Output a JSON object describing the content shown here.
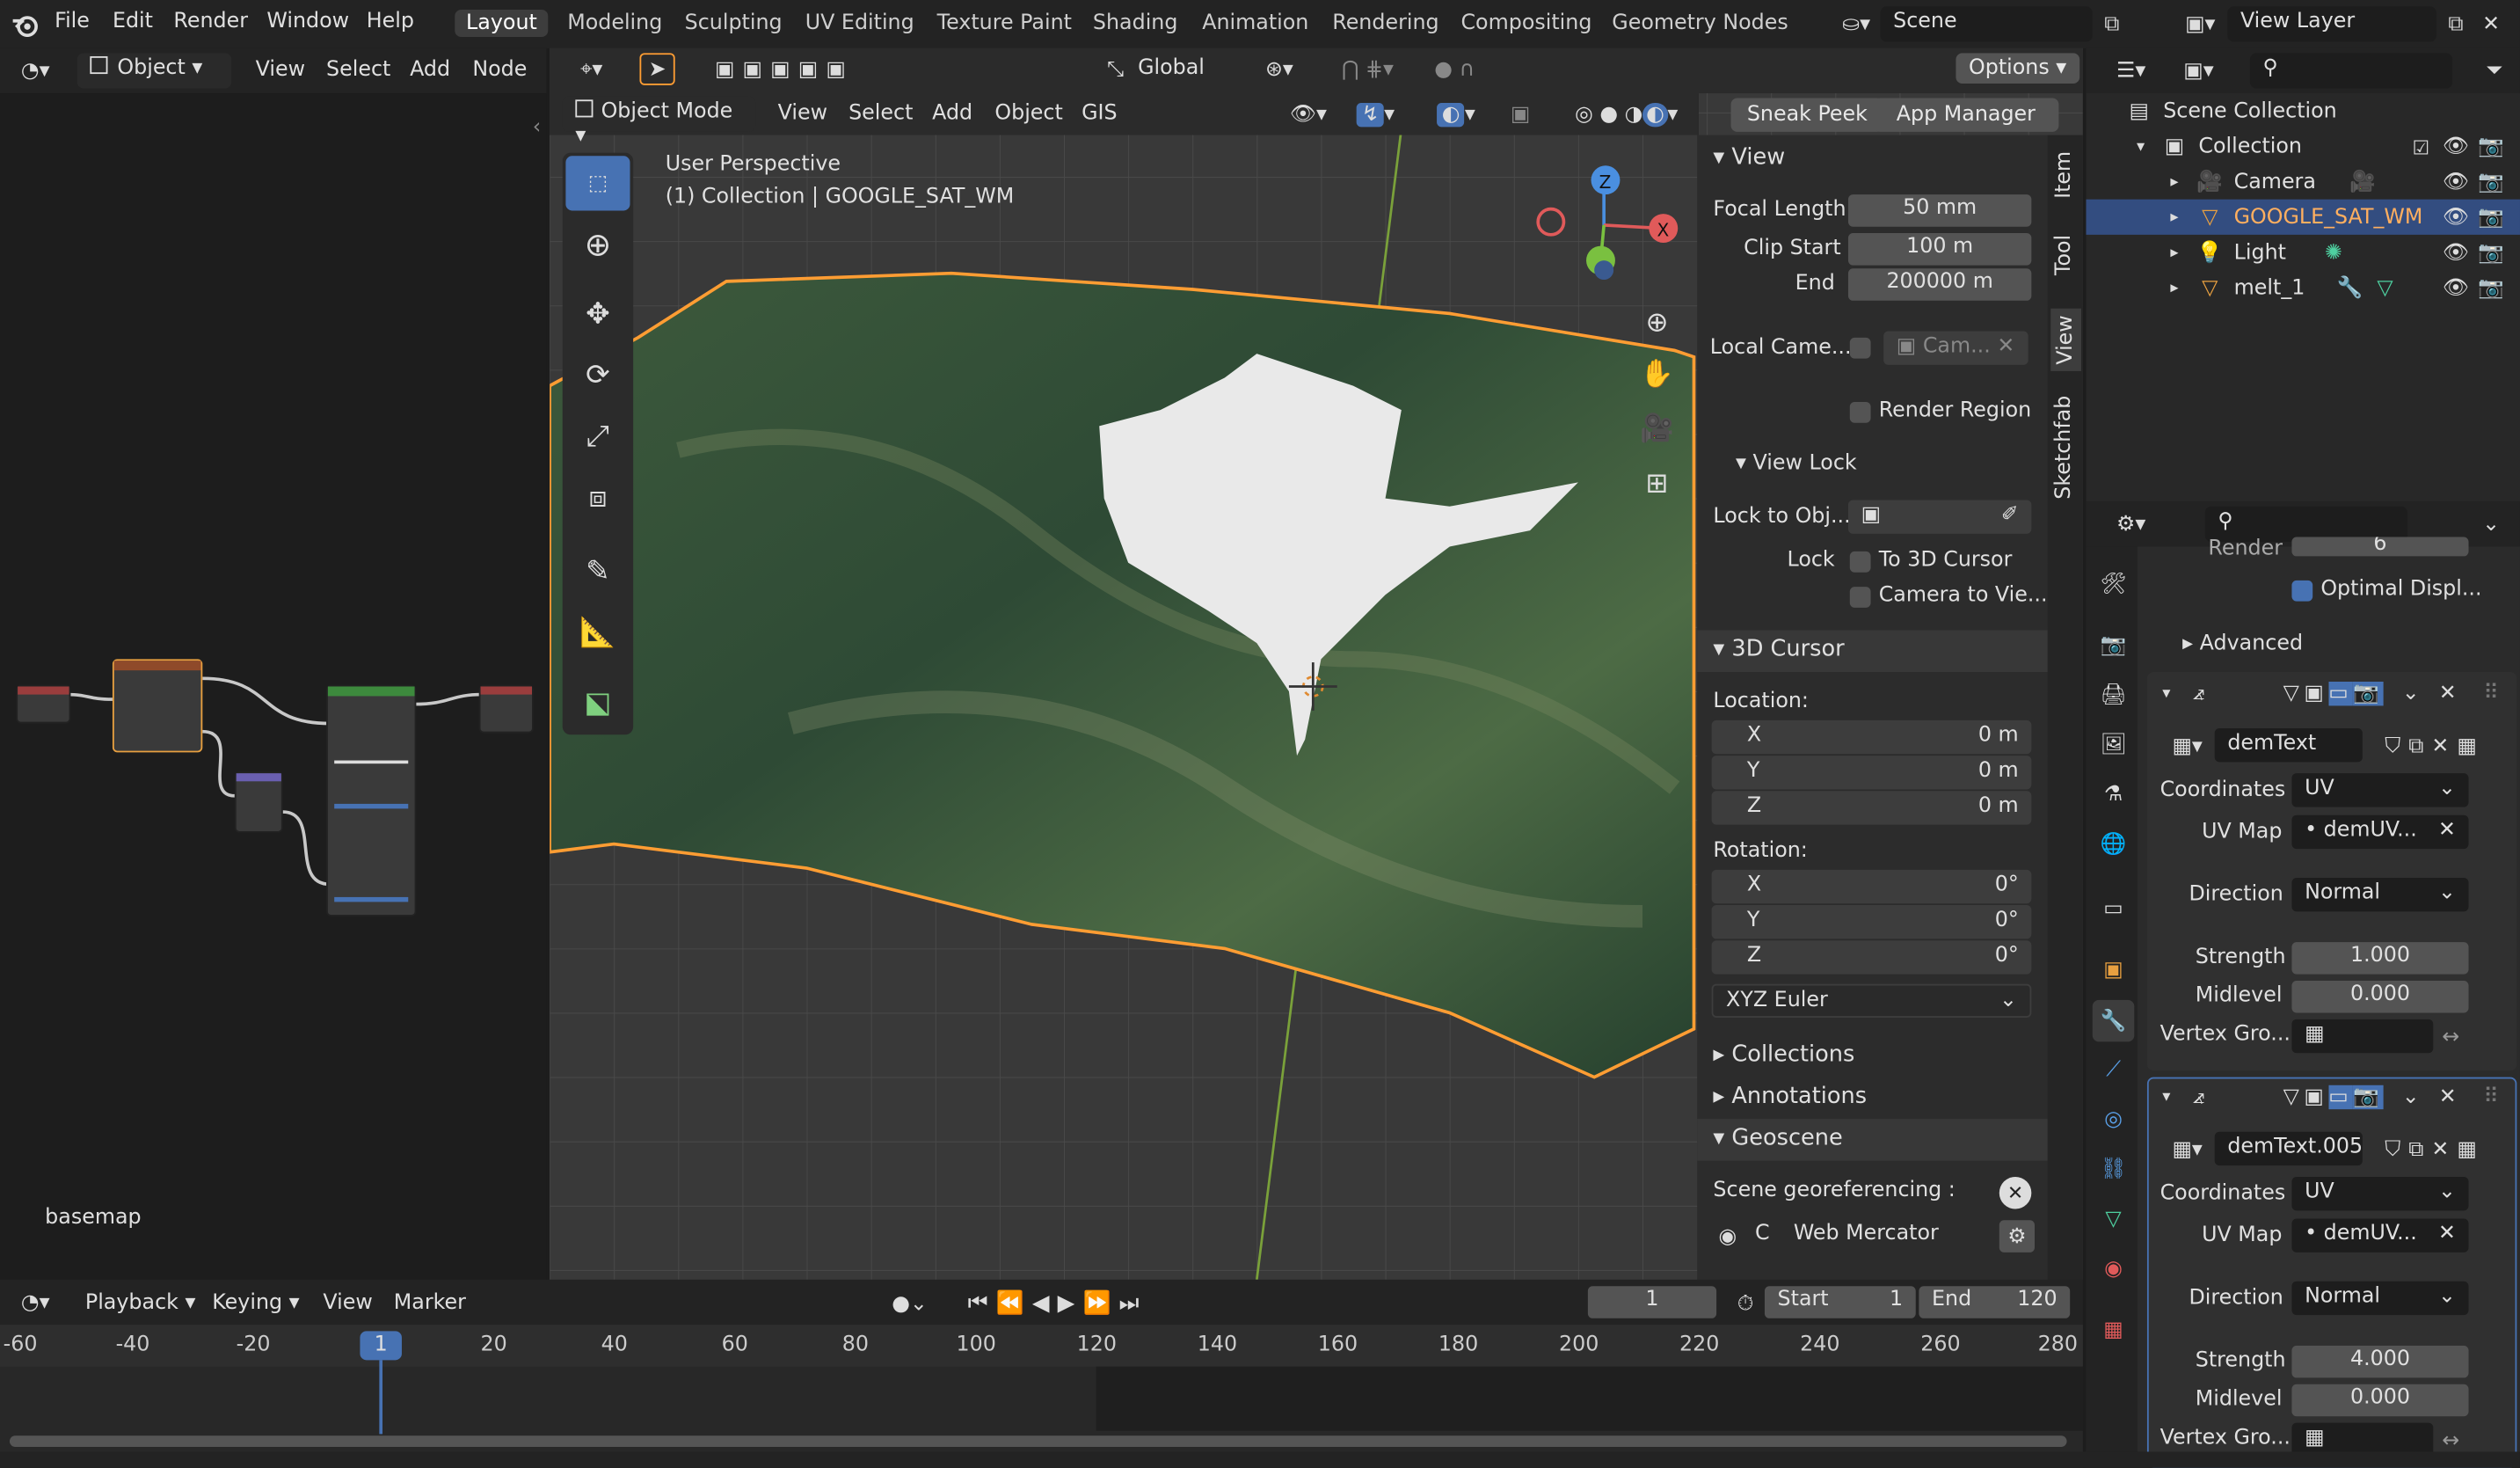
{
  "app": {
    "logo": "blender-logo"
  },
  "menu": [
    "File",
    "Edit",
    "Render",
    "Window",
    "Help"
  ],
  "workspaces": [
    "Layout",
    "Modeling",
    "Sculpting",
    "UV Editing",
    "Texture Paint",
    "Shading",
    "Animation",
    "Rendering",
    "Compositing",
    "Geometry Nodes"
  ],
  "scene": {
    "label": "Scene",
    "view_layer": "View Layer"
  },
  "node_editor": {
    "mode": "Object",
    "menus": [
      "View",
      "Select",
      "Add",
      "Node"
    ],
    "label": "basemap"
  },
  "viewport": {
    "header_menus": [
      "View",
      "Select",
      "Add",
      "Object",
      "GIS"
    ],
    "mode": "Object Mode",
    "orientation": "Global",
    "options": "Options",
    "sneak_peek": "Sneak Peek",
    "app_manager": "App Manager",
    "overlay_line1": "User Perspective",
    "overlay_line2": "(1) Collection | GOOGLE_SAT_WM",
    "gizmo": {
      "z": "Z",
      "x": "X"
    }
  },
  "npanel": {
    "tabs": [
      "Item",
      "Tool",
      "View",
      "Sketchfab"
    ],
    "view": {
      "title": "View",
      "focal_length_label": "Focal Length",
      "focal_length": "50 mm",
      "clip_start_label": "Clip Start",
      "clip_start": "100 m",
      "end_label": "End",
      "end": "200000 m",
      "local_camera_label": "Local Came...",
      "local_camera_field": "Cam...",
      "render_region": "Render Region"
    },
    "view_lock": {
      "title": "View Lock",
      "lock_to_obj": "Lock to Obj...",
      "lock_label": "Lock",
      "to_3d_cursor": "To 3D Cursor",
      "camera_to_view": "Camera to Vie..."
    },
    "cursor": {
      "title": "3D Cursor",
      "location": "Location:",
      "rotation": "Rotation:",
      "x": "X",
      "y": "Y",
      "z": "Z",
      "loc_x": "0 m",
      "loc_y": "0 m",
      "loc_z": "0 m",
      "rot_x": "0°",
      "rot_y": "0°",
      "rot_z": "0°",
      "rot_mode": "XYZ Euler"
    },
    "collections": "Collections",
    "annotations": "Annotations",
    "geoscene": "Geoscene",
    "georef": {
      "label": "Scene georeferencing :",
      "crs_prefix": "C",
      "crs": "Web Mercator"
    }
  },
  "outliner": {
    "scene_collection": "Scene Collection",
    "items": [
      {
        "name": "Collection"
      },
      {
        "name": "Camera"
      },
      {
        "name": "GOOGLE_SAT_WM"
      },
      {
        "name": "Light"
      },
      {
        "name": "melt_1"
      }
    ]
  },
  "properties": {
    "render_label": "Render",
    "render_value": "6",
    "optimal_display": "Optimal Displ...",
    "advanced": "Advanced",
    "mod1": {
      "texture": "demText",
      "coordinates_label": "Coordinates",
      "coordinates": "UV",
      "uvmap_label": "UV Map",
      "uvmap": "demUV...",
      "direction_label": "Direction",
      "direction": "Normal",
      "strength_label": "Strength",
      "strength": "1.000",
      "midlevel_label": "Midlevel",
      "midlevel": "0.000",
      "vgroup_label": "Vertex Gro..."
    },
    "mod2": {
      "texture": "demText.005",
      "coordinates_label": "Coordinates",
      "coordinates": "UV",
      "uvmap_label": "UV Map",
      "uvmap": "demUV...",
      "direction_label": "Direction",
      "direction": "Normal",
      "strength_label": "Strength",
      "strength": "4.000",
      "midlevel_label": "Midlevel",
      "midlevel": "0.000",
      "vgroup_label": "Vertex Gro..."
    }
  },
  "timeline": {
    "menus": [
      "Playback",
      "Keying",
      "View",
      "Marker"
    ],
    "current_frame": "1",
    "start_label": "Start",
    "start": "1",
    "end_label": "End",
    "end": "120",
    "ticks": [
      "-60",
      "-40",
      "-20",
      "1",
      "20",
      "40",
      "60",
      "80",
      "100",
      "120",
      "140",
      "160",
      "180",
      "200",
      "220",
      "240",
      "260",
      "280"
    ]
  }
}
